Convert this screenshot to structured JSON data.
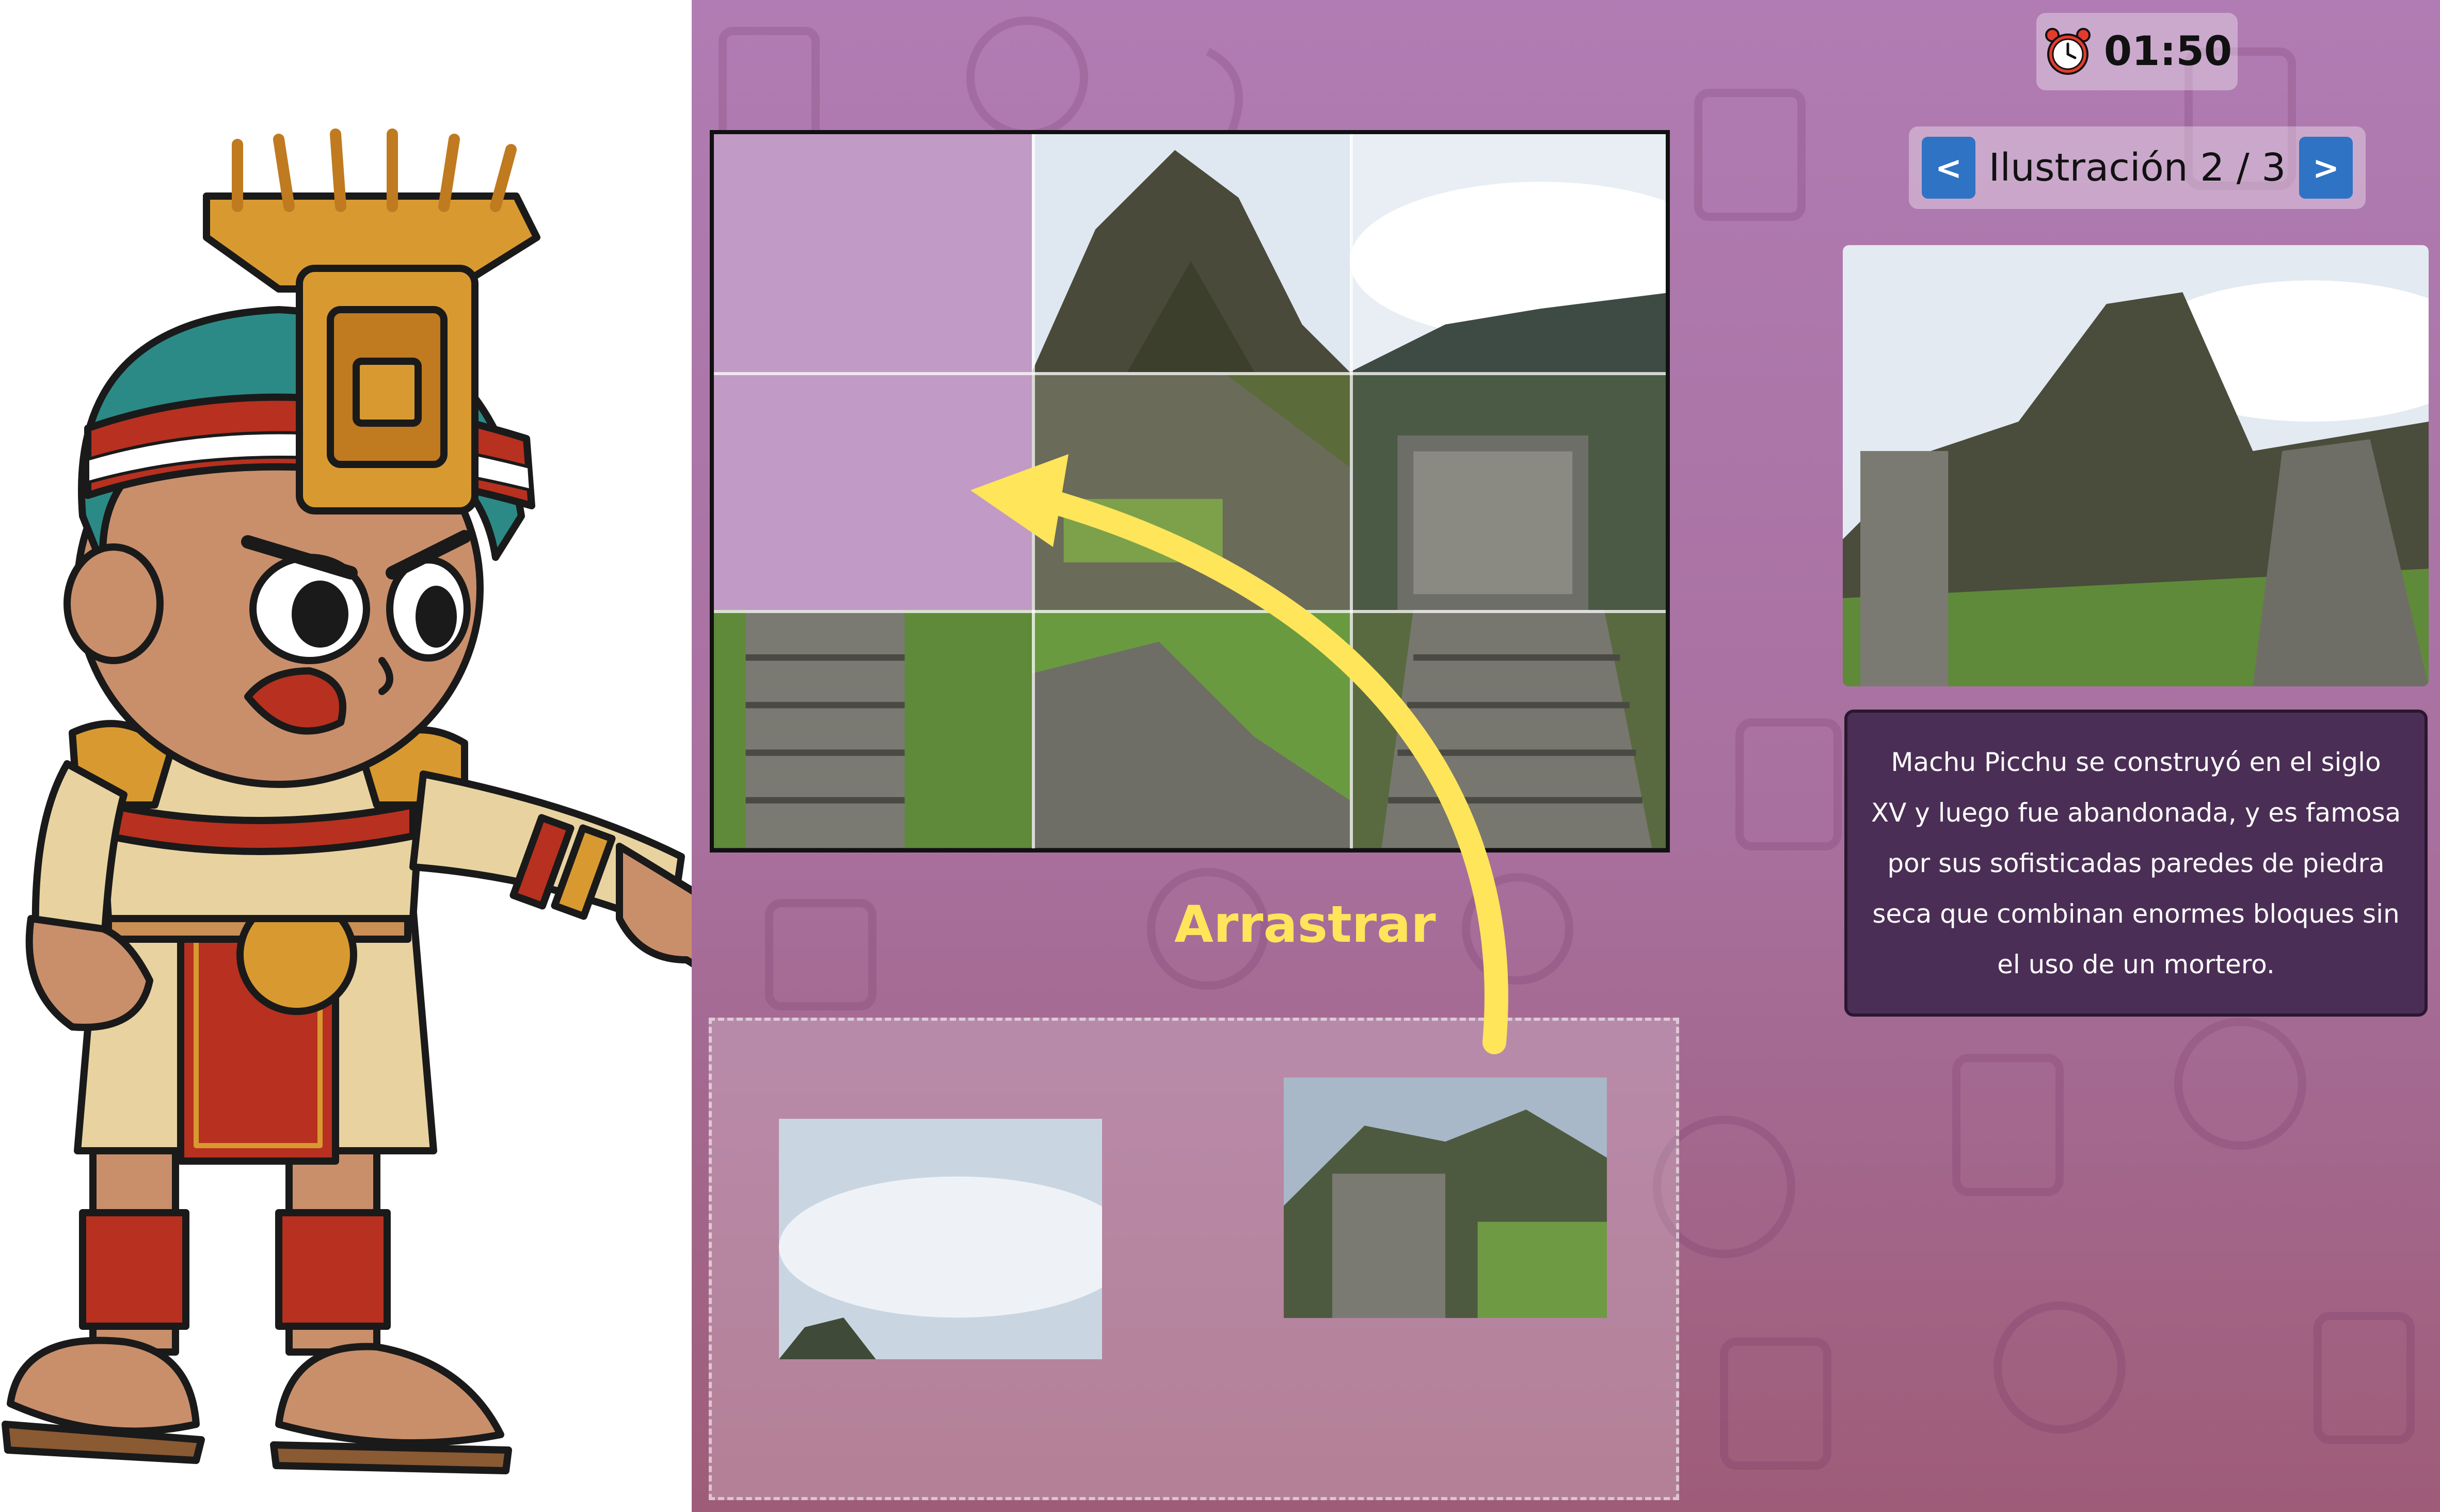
{
  "timer": {
    "icon": "alarm-clock-icon",
    "value": "01:50"
  },
  "navigation": {
    "prev_label": "<",
    "next_label": ">",
    "title": "Ilustración 2 / 3"
  },
  "puzzle": {
    "drag_hint": "Arrastrar",
    "grid_rows": 3,
    "grid_cols": 3,
    "empty_cells": 2,
    "tray_pieces": 2
  },
  "description": "Machu Picchu se construyó en el siglo XV y luego fue abandonada, y es famosa por sus sofisticadas paredes de piedra seca que combinan enormes bloques sin el uso de un mortero.",
  "colors": {
    "background_top": "#b07cb3",
    "background_bottom": "#9e5c78",
    "nav_button": "#2e73c4",
    "arrow": "#ffe55a",
    "description_bg": "#4b2e55"
  }
}
